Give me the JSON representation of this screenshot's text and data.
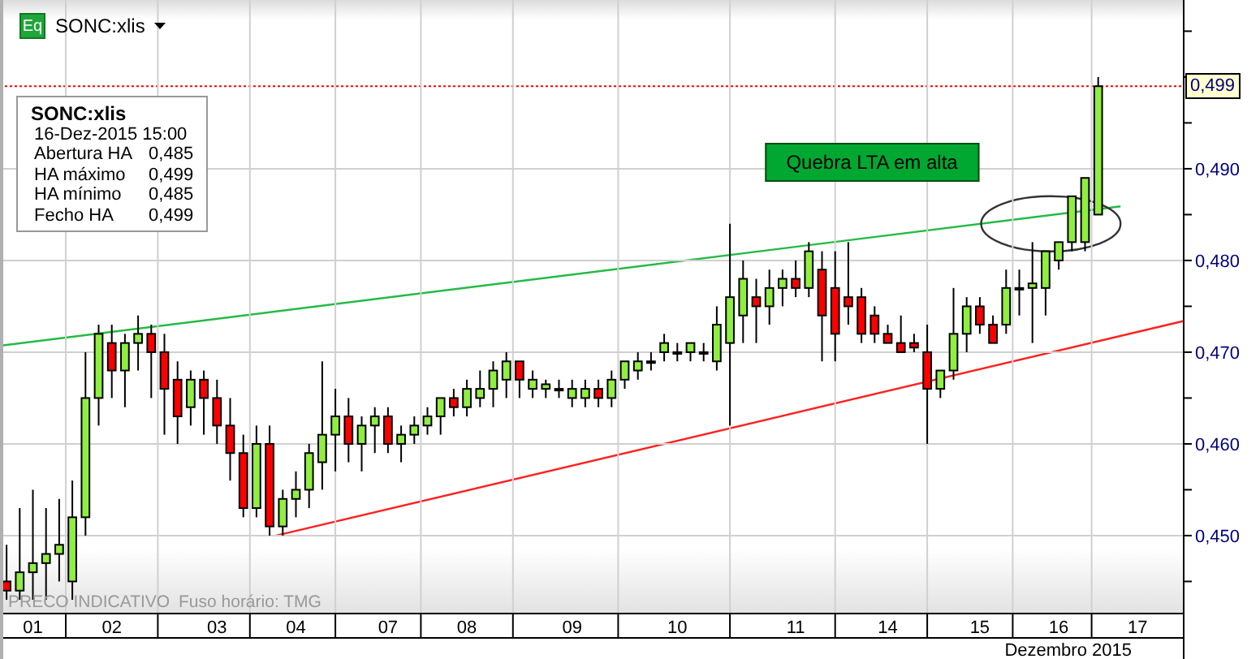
{
  "header": {
    "badge": "Eq",
    "symbol": "SONC:xlis"
  },
  "info_box": {
    "title": "SONC:xlis",
    "datetime": "16-Dez-2015 15:00",
    "rows": [
      {
        "label": "Abertura HA",
        "value": "0,485"
      },
      {
        "label": "HA máximo",
        "value": "0,499"
      },
      {
        "label": "HA mínimo",
        "value": "0,485"
      },
      {
        "label": "Fecho HA",
        "value": "0,499"
      }
    ]
  },
  "chart": {
    "annotation_label": "Quebra LTA em alta",
    "last_price": "0,499",
    "footer_note": "PRECO INDICATIVO",
    "timezone": "Fuso horário: TMG",
    "month_label": "Dezembro 2015",
    "chart_data": {
      "type": "candlestick",
      "grid": true,
      "ylim": [
        0.4415,
        0.5084
      ],
      "categories": [
        null,
        null,
        "01",
        null,
        null,
        null,
        null,
        null,
        "02",
        null,
        null,
        null,
        null,
        null,
        null,
        null,
        "03",
        null,
        null,
        null,
        null,
        null,
        "04",
        null,
        null,
        null,
        null,
        null,
        null,
        "07",
        null,
        null,
        null,
        null,
        null,
        "08",
        null,
        null,
        null,
        null,
        null,
        null,
        null,
        "09",
        null,
        null,
        null,
        null,
        null,
        null,
        null,
        "10",
        null,
        null,
        null,
        null,
        null,
        null,
        null,
        null,
        "11",
        null,
        null,
        null,
        null,
        null,
        null,
        "14",
        null,
        null,
        null,
        null,
        null,
        null,
        "15",
        null,
        null,
        null,
        null,
        null,
        "16",
        null,
        null,
        null,
        null,
        null,
        "17",
        null,
        null,
        null
      ],
      "yticks": [
        {
          "value": 0.49,
          "label": "0,490"
        },
        {
          "value": 0.48,
          "label": "0,480"
        },
        {
          "value": 0.47,
          "label": "0,470"
        },
        {
          "value": 0.46,
          "label": "0,460"
        },
        {
          "value": 0.45,
          "label": "0,450"
        }
      ],
      "ohlc": [
        [
          0.445,
          0.449,
          0.443,
          0.444
        ],
        [
          0.444,
          0.453,
          0.443,
          0.446
        ],
        [
          0.446,
          0.455,
          0.443,
          0.447
        ],
        [
          0.447,
          0.453,
          0.443,
          0.448
        ],
        [
          0.448,
          0.454,
          0.445,
          0.449
        ],
        [
          0.445,
          0.456,
          0.443,
          0.452
        ],
        [
          0.452,
          0.47,
          0.45,
          0.465
        ],
        [
          0.465,
          0.473,
          0.462,
          0.472
        ],
        [
          0.471,
          0.473,
          0.465,
          0.468
        ],
        [
          0.468,
          0.472,
          0.464,
          0.471
        ],
        [
          0.471,
          0.474,
          0.468,
          0.472
        ],
        [
          0.472,
          0.473,
          0.465,
          0.47
        ],
        [
          0.47,
          0.472,
          0.461,
          0.466
        ],
        [
          0.467,
          0.469,
          0.46,
          0.463
        ],
        [
          0.464,
          0.468,
          0.462,
          0.467
        ],
        [
          0.467,
          0.468,
          0.461,
          0.465
        ],
        [
          0.465,
          0.467,
          0.46,
          0.462
        ],
        [
          0.462,
          0.465,
          0.456,
          0.459
        ],
        [
          0.459,
          0.461,
          0.452,
          0.453
        ],
        [
          0.453,
          0.462,
          0.452,
          0.46
        ],
        [
          0.46,
          0.462,
          0.45,
          0.451
        ],
        [
          0.451,
          0.455,
          0.45,
          0.454
        ],
        [
          0.454,
          0.457,
          0.452,
          0.455
        ],
        [
          0.455,
          0.46,
          0.453,
          0.459
        ],
        [
          0.458,
          0.469,
          0.455,
          0.461
        ],
        [
          0.461,
          0.466,
          0.457,
          0.463
        ],
        [
          0.463,
          0.465,
          0.458,
          0.46
        ],
        [
          0.46,
          0.463,
          0.457,
          0.462
        ],
        [
          0.462,
          0.464,
          0.459,
          0.463
        ],
        [
          0.463,
          0.464,
          0.459,
          0.46
        ],
        [
          0.46,
          0.462,
          0.458,
          0.461
        ],
        [
          0.461,
          0.463,
          0.46,
          0.462
        ],
        [
          0.462,
          0.464,
          0.461,
          0.463
        ],
        [
          0.463,
          0.465,
          0.461,
          0.465
        ],
        [
          0.465,
          0.466,
          0.463,
          0.464
        ],
        [
          0.464,
          0.467,
          0.463,
          0.466
        ],
        [
          0.465,
          0.468,
          0.464,
          0.466
        ],
        [
          0.466,
          0.469,
          0.464,
          0.468
        ],
        [
          0.467,
          0.47,
          0.465,
          0.469
        ],
        [
          0.469,
          0.469,
          0.465,
          0.467
        ],
        [
          0.466,
          0.468,
          0.465,
          0.467
        ],
        [
          0.466,
          0.467,
          0.465,
          0.4665
        ],
        [
          0.466,
          0.467,
          0.465,
          0.466
        ],
        [
          0.465,
          0.467,
          0.464,
          0.466
        ],
        [
          0.465,
          0.467,
          0.464,
          0.466
        ],
        [
          0.466,
          0.467,
          0.464,
          0.465
        ],
        [
          0.465,
          0.468,
          0.464,
          0.467
        ],
        [
          0.467,
          0.469,
          0.466,
          0.469
        ],
        [
          0.468,
          0.47,
          0.467,
          0.469
        ],
        [
          0.469,
          0.47,
          0.468,
          0.469
        ],
        [
          0.47,
          0.472,
          0.469,
          0.471
        ],
        [
          0.47,
          0.471,
          0.469,
          0.47
        ],
        [
          0.47,
          0.471,
          0.469,
          0.471
        ],
        [
          0.47,
          0.471,
          0.469,
          0.47
        ],
        [
          0.469,
          0.475,
          0.468,
          0.473
        ],
        [
          0.471,
          0.484,
          0.462,
          0.476
        ],
        [
          0.474,
          0.48,
          0.471,
          0.478
        ],
        [
          0.476,
          0.478,
          0.471,
          0.475
        ],
        [
          0.475,
          0.479,
          0.473,
          0.477
        ],
        [
          0.477,
          0.479,
          0.475,
          0.478
        ],
        [
          0.478,
          0.48,
          0.476,
          0.477
        ],
        [
          0.477,
          0.482,
          0.476,
          0.481
        ],
        [
          0.479,
          0.481,
          0.469,
          0.474
        ],
        [
          0.477,
          0.481,
          0.469,
          0.472
        ],
        [
          0.476,
          0.482,
          0.473,
          0.475
        ],
        [
          0.476,
          0.477,
          0.471,
          0.472
        ],
        [
          0.474,
          0.475,
          0.471,
          0.472
        ],
        [
          0.472,
          0.473,
          0.471,
          0.471
        ],
        [
          0.471,
          0.474,
          0.47,
          0.47
        ],
        [
          0.471,
          0.472,
          0.47,
          0.4705
        ],
        [
          0.47,
          0.473,
          0.46,
          0.466
        ],
        [
          0.466,
          0.468,
          0.465,
          0.468
        ],
        [
          0.468,
          0.477,
          0.467,
          0.472
        ],
        [
          0.472,
          0.476,
          0.47,
          0.475
        ],
        [
          0.475,
          0.476,
          0.472,
          0.473
        ],
        [
          0.473,
          0.474,
          0.471,
          0.471
        ],
        [
          0.473,
          0.479,
          0.472,
          0.477
        ],
        [
          0.477,
          0.479,
          0.474,
          0.477
        ],
        [
          0.477,
          0.482,
          0.471,
          0.4775
        ],
        [
          0.477,
          0.481,
          0.474,
          0.481
        ],
        [
          0.48,
          0.482,
          0.479,
          0.482
        ],
        [
          0.482,
          0.487,
          0.481,
          0.487
        ],
        [
          0.482,
          0.489,
          0.481,
          0.489
        ],
        [
          0.485,
          0.5,
          0.485,
          0.499
        ],
        null,
        null,
        null,
        null,
        null,
        null
      ]
    }
  }
}
